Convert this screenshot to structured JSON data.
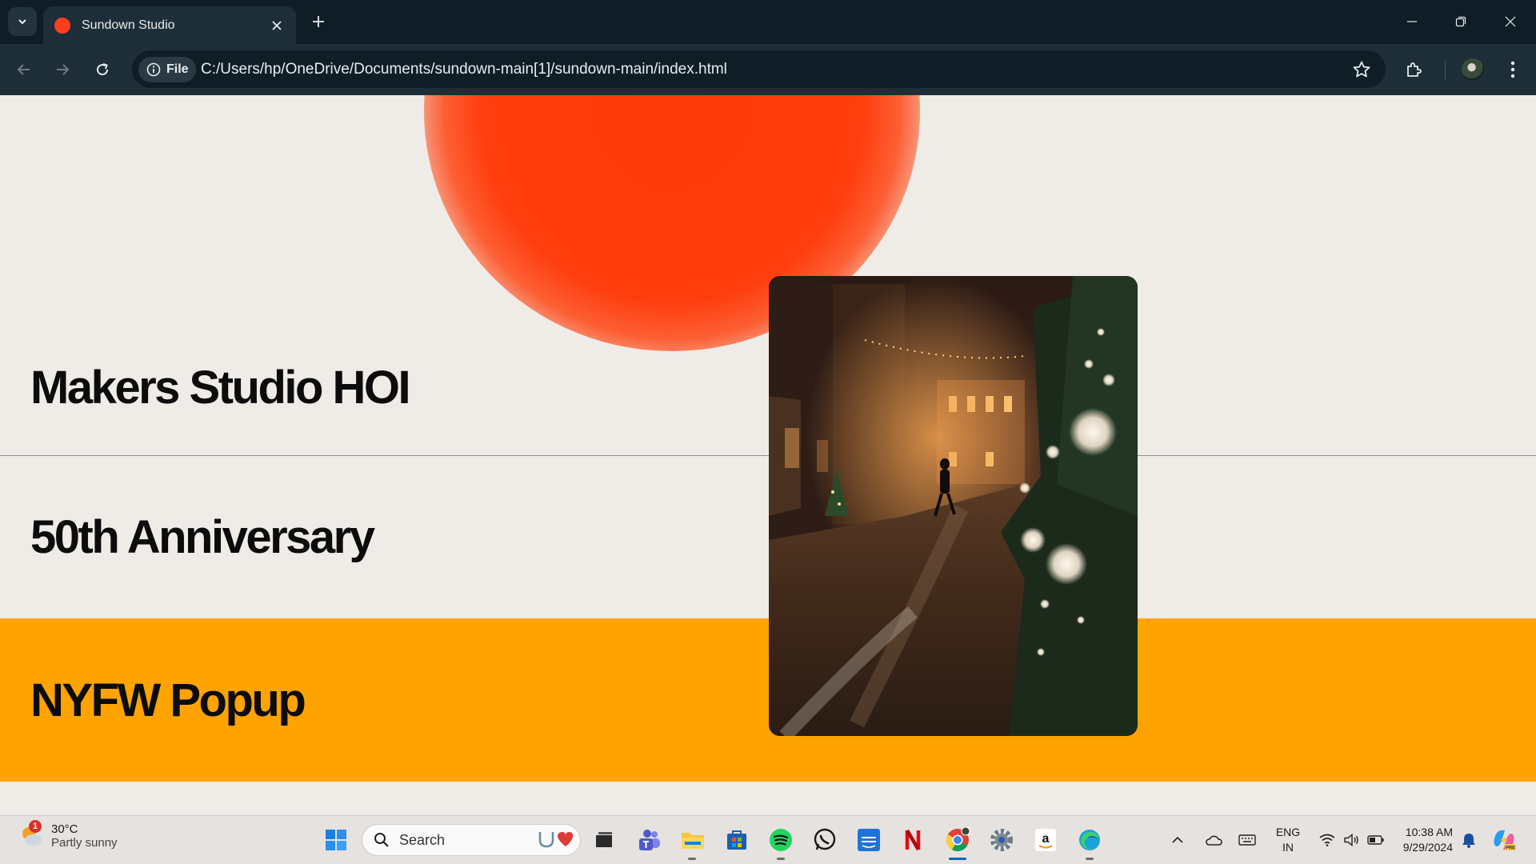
{
  "browser": {
    "tab_title": "Sundown Studio",
    "file_chip": "File",
    "url": "C:/Users/hp/OneDrive/Documents/sundown-main[1]/sundown-main/index.html"
  },
  "page": {
    "rows": [
      {
        "label": "Makers Studio HOI"
      },
      {
        "label": "50th Anniversary"
      },
      {
        "label": "NYFW Popup"
      }
    ],
    "colors": {
      "background": "#efebe7",
      "sun": "#ff3d0d",
      "highlight_row": "#ffa300"
    }
  },
  "taskbar": {
    "weather_badge": "1",
    "weather_temp": "30°C",
    "weather_desc": "Partly sunny",
    "search_placeholder": "Search",
    "language_line1": "ENG",
    "language_line2": "IN",
    "time": "10:38 AM",
    "date": "9/29/2024"
  }
}
